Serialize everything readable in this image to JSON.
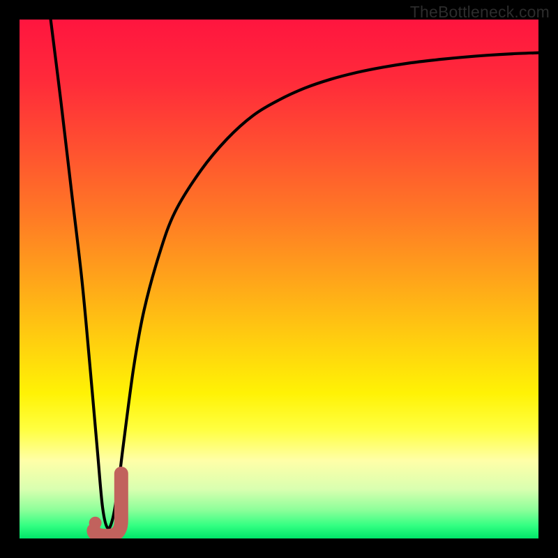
{
  "watermark": "TheBottleneck.com",
  "colors": {
    "frame": "#000000",
    "curve": "#000000",
    "marker": "#c1625d",
    "gradient_stops": [
      {
        "offset": 0.0,
        "color": "#ff153f"
      },
      {
        "offset": 0.12,
        "color": "#ff2b3a"
      },
      {
        "offset": 0.25,
        "color": "#ff5130"
      },
      {
        "offset": 0.38,
        "color": "#ff7a25"
      },
      {
        "offset": 0.5,
        "color": "#ffa41a"
      },
      {
        "offset": 0.62,
        "color": "#ffcf0f"
      },
      {
        "offset": 0.72,
        "color": "#fff205"
      },
      {
        "offset": 0.79,
        "color": "#ffff40"
      },
      {
        "offset": 0.85,
        "color": "#ffffa8"
      },
      {
        "offset": 0.905,
        "color": "#d9ffb0"
      },
      {
        "offset": 0.945,
        "color": "#8dff9a"
      },
      {
        "offset": 0.975,
        "color": "#33ff82"
      },
      {
        "offset": 1.0,
        "color": "#00e66a"
      }
    ]
  },
  "chart_data": {
    "type": "line",
    "title": "",
    "xlabel": "",
    "ylabel": "",
    "xlim": [
      0,
      100
    ],
    "ylim": [
      0,
      100
    ],
    "series": [
      {
        "name": "bottleneck-curve",
        "x": [
          6,
          8,
          10,
          12,
          13.5,
          15,
          16,
          17,
          18,
          19,
          20,
          22,
          24,
          27,
          30,
          35,
          40,
          45,
          50,
          55,
          60,
          65,
          70,
          75,
          80,
          85,
          90,
          95,
          100
        ],
        "y": [
          100,
          84,
          67,
          50,
          34,
          17,
          6,
          2,
          4,
          10,
          18,
          33,
          44,
          55,
          63,
          71,
          77,
          81.5,
          84.5,
          86.8,
          88.5,
          89.8,
          90.8,
          91.6,
          92.2,
          92.7,
          93.1,
          93.4,
          93.6
        ]
      }
    ],
    "marker": {
      "name": "result-marker-J",
      "shape": "J",
      "x_range": [
        14.3,
        19.6
      ],
      "y_range": [
        0.5,
        12.5
      ],
      "dot": {
        "x": 14.6,
        "y": 3.0
      }
    }
  }
}
